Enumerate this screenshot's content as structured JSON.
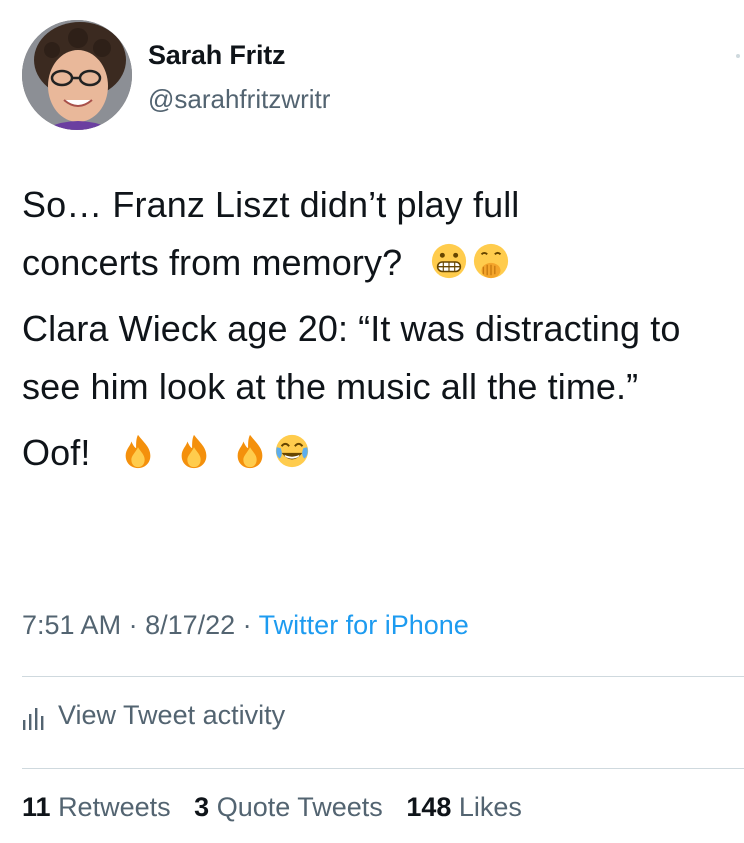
{
  "author": {
    "name": "Sarah Fritz",
    "handle": "@sarahfritzwritr"
  },
  "tweet": {
    "line1": "So… Franz Liszt didn’t play full",
    "line2": "concerts from memory?",
    "line2_emojis": [
      "grimacing-face",
      "face-with-hand-over-mouth"
    ],
    "para2": "Clara Wieck age 20: “It was distracting to see him look at the music all the time.”",
    "para3_text": "Oof!",
    "para3_emojis": [
      "fire",
      "fire",
      "fire",
      "face-with-tears-of-joy"
    ]
  },
  "meta": {
    "time": "7:51 AM",
    "separator": " · ",
    "date": "8/17/22",
    "source": "Twitter for iPhone"
  },
  "activity": {
    "label": "View Tweet activity",
    "icon": "bar-chart-icon"
  },
  "stats": {
    "retweets_count": "11",
    "retweets_label": "Retweets",
    "quotes_count": "3",
    "quotes_label": "Quote Tweets",
    "likes_count": "148",
    "likes_label": "Likes"
  },
  "colors": {
    "text": "#0f1419",
    "secondary": "#536471",
    "link": "#1d9bf0",
    "divider": "#cfd9de"
  }
}
